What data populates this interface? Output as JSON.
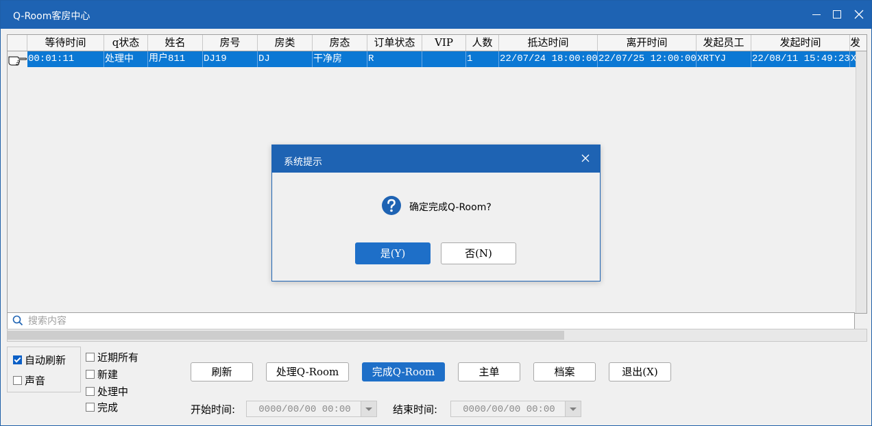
{
  "window": {
    "title": "Q-Room客房中心"
  },
  "grid": {
    "columns": [
      "等待时间",
      "q状态",
      "姓名",
      "房号",
      "房类",
      "房态",
      "订单状态",
      "VIP",
      "人数",
      "抵达时间",
      "离开时间",
      "发起员工",
      "发起时间",
      "发"
    ],
    "rows": [
      [
        "00:01:11",
        "处理中",
        "用户811",
        "DJ19",
        "DJ",
        "干净房",
        "R",
        "",
        "1",
        "22/07/24 18:00:00",
        "22/07/25 12:00:00",
        "XRTYJ",
        "22/08/11 15:49:23",
        "X"
      ]
    ]
  },
  "search": {
    "placeholder": "搜索内容",
    "value": ""
  },
  "options": {
    "auto_refresh": {
      "label": "自动刷新",
      "checked": true
    },
    "sound": {
      "label": "声音",
      "checked": false
    }
  },
  "filters": [
    {
      "label": "近期所有",
      "checked": false
    },
    {
      "label": "新建",
      "checked": false
    },
    {
      "label": "处理中",
      "checked": false
    },
    {
      "label": "完成",
      "checked": false
    }
  ],
  "toolbar": {
    "refresh": "刷新",
    "process": "处理Q-Room",
    "complete": "完成Q-Room",
    "master": "主单",
    "archive": "档案",
    "exit": "退出(X)"
  },
  "dates": {
    "start_label": "开始时间:",
    "start_value": "0000/00/00 00:00",
    "end_label": "结束时间:",
    "end_value": "0000/00/00 00:00"
  },
  "dialog": {
    "title": "系统提示",
    "message": "确定完成Q-Room?",
    "yes": "是(Y)",
    "no": "否(N)"
  },
  "colors": {
    "title_bar": "#1e63b3",
    "selection": "#0b78d4",
    "primary_button": "#1e6fc8"
  }
}
